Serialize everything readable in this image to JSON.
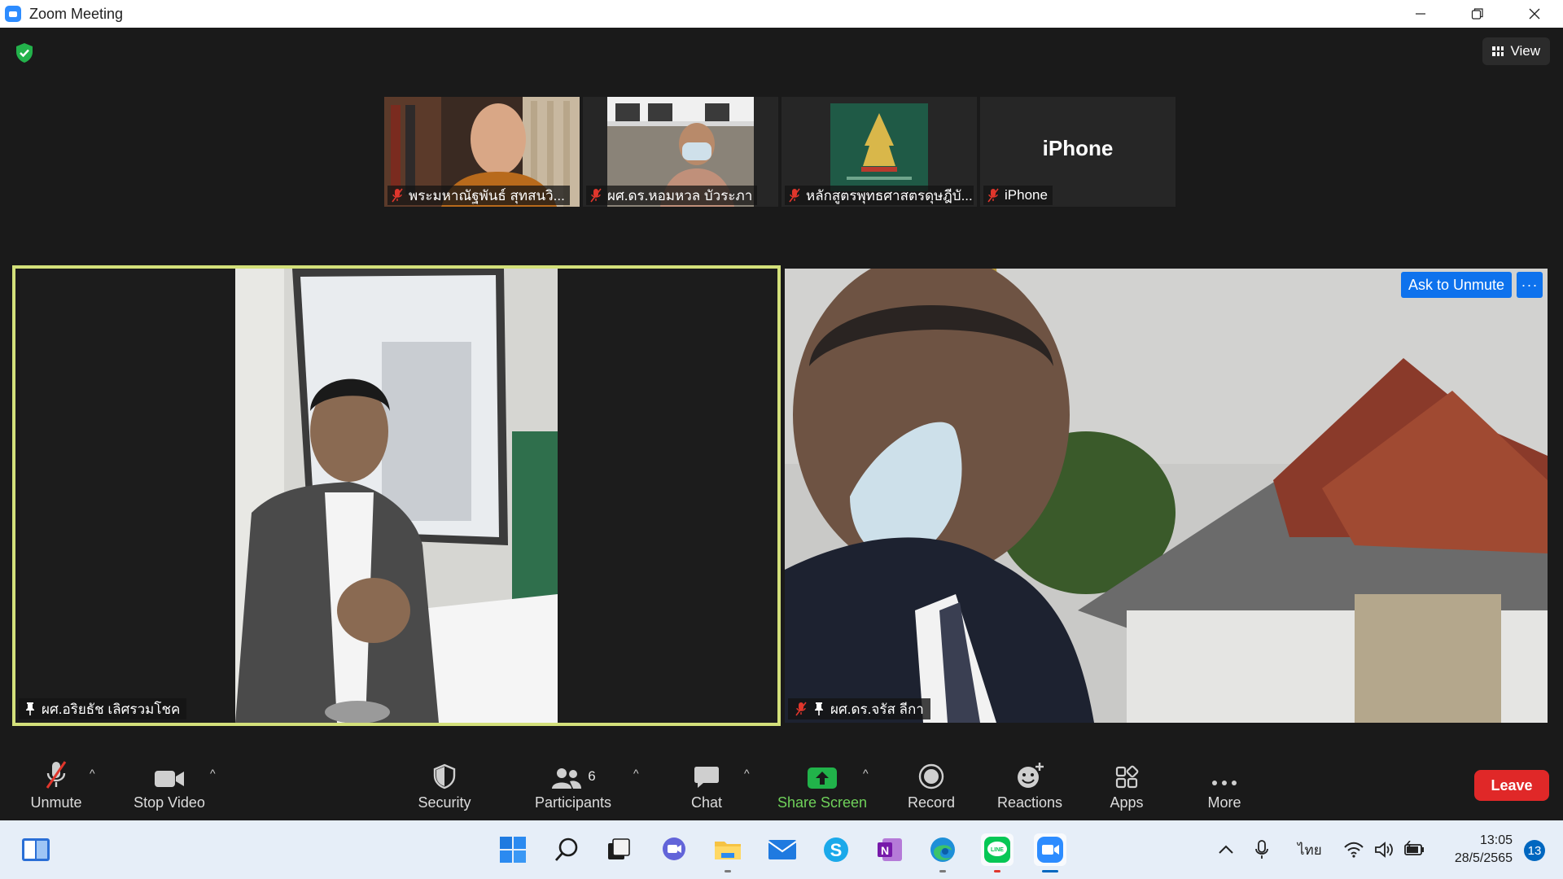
{
  "window": {
    "title": "Zoom Meeting"
  },
  "top_bar": {
    "view_label": "View"
  },
  "thumbnails": [
    {
      "name": "พระมหาณัฐพันธ์ สุทสนวิ...",
      "muted": true
    },
    {
      "name": "ผศ.ดร.หอมหวล บัวระภา",
      "muted": true
    },
    {
      "name": "หลักสูตรพุทธศาสตรดุษฎีบั...",
      "muted": true
    },
    {
      "name": "iPhone",
      "muted": true,
      "placeholder_text": "iPhone"
    }
  ],
  "main_videos": {
    "left": {
      "name": "ผศ.อริยธัช เลิศรวมโชค",
      "pinned": true,
      "active_speaker": true
    },
    "right": {
      "name": "ผศ.ดร.จรัส ลีกา",
      "pinned": true,
      "muted": true,
      "ask_to_unmute_label": "Ask to Unmute",
      "more_label": "···"
    }
  },
  "toolbar": {
    "unmute_label": "Unmute",
    "stop_video_label": "Stop Video",
    "security_label": "Security",
    "participants_label": "Participants",
    "participants_count": "6",
    "chat_label": "Chat",
    "share_screen_label": "Share Screen",
    "record_label": "Record",
    "reactions_label": "Reactions",
    "apps_label": "Apps",
    "more_label": "More",
    "leave_label": "Leave"
  },
  "taskbar": {
    "apps": [
      "widgets-icon",
      "start-icon",
      "search-icon",
      "task-view-icon",
      "teams-chat-icon",
      "file-explorer-icon",
      "mail-icon",
      "skype-icon",
      "onenote-icon",
      "edge-icon",
      "line-icon",
      "zoom-icon"
    ],
    "language": "ไทย",
    "time": "13:05",
    "date": "28/5/2565",
    "notification_count": "13"
  },
  "colors": {
    "active_speaker_border": "#d3e07a",
    "ask_unmute_blue": "#0e72ed",
    "share_screen_green": "#6fd15a",
    "leave_red": "#e02828",
    "muted_mic_red": "#e0362c"
  }
}
